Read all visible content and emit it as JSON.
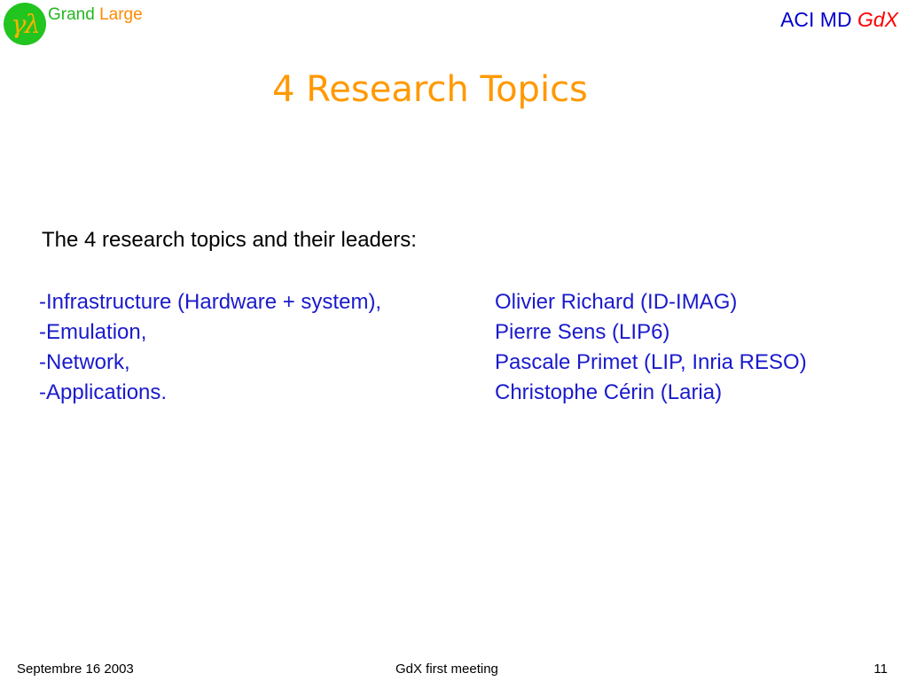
{
  "logo": {
    "symbol": "γλ",
    "word1": "Grand",
    "word2": "Large"
  },
  "header": {
    "project": "ACI MD ",
    "project_name": "GdX"
  },
  "slide": {
    "title": "4 Research Topics",
    "intro": "The 4 research topics and their leaders:",
    "topics": [
      {
        "name": "-Infrastructure (Hardware + system),",
        "leader": "Olivier Richard (ID-IMAG)"
      },
      {
        "name": "-Emulation,",
        "leader": "Pierre Sens (LIP6)"
      },
      {
        "name": "-Network,",
        "leader": "Pascale Primet (LIP, Inria RESO)"
      },
      {
        "name": "-Applications.",
        "leader": "Christophe Cérin (Laria)"
      }
    ]
  },
  "footer": {
    "date": "Septembre 16 2003",
    "event": "GdX first meeting",
    "page": "11"
  },
  "colors": {
    "title": "#ff9900",
    "body_text": "#1a1acc",
    "logo_circle": "#22c41f",
    "logo_grand": "#22b81f",
    "logo_large": "#ff8a00",
    "header_blue": "#0000cc",
    "header_red": "#ff0000"
  }
}
